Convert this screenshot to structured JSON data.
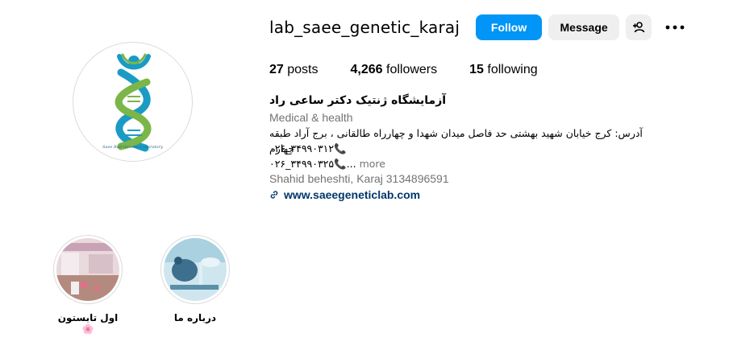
{
  "profile": {
    "username": "lab_saee_genetic_karaj",
    "avatar_caption": "Saee Rad Genetic Laboratory",
    "buttons": {
      "follow": "Follow",
      "message": "Message"
    },
    "stats": {
      "posts_count": "27",
      "posts_label": "posts",
      "followers_count": "4,266",
      "followers_label": "followers",
      "following_count": "15",
      "following_label": "following"
    },
    "bio": {
      "full_name": "آزمایشگاه ژنتیک دکتر ساعی راد",
      "category": "Medical & health",
      "line1": "آدرس: کرج خیابان شهید بهشتی حد فاصل میدان شهدا و چهارراه طالقانی ، برج آراد طبقه چهارم",
      "phone1": "۰۲۶_۳۴۹۹۰۳۱۲",
      "phone2": "۰۲۶_۳۴۹۹۰۳۲۵",
      "more": "more",
      "address": "Shahid beheshti, Karaj 3134896591",
      "website": "www.saeegeneticlab.com"
    }
  },
  "highlights": [
    {
      "label": "اول تابستون🌸"
    },
    {
      "label": "درباره ما"
    }
  ],
  "colors": {
    "follow_blue": "#0095f6",
    "button_gray": "#efefef",
    "link_blue": "#00376b",
    "secondary_text": "#737373",
    "dna_teal": "#1a9bc4",
    "dna_green": "#7ab648"
  },
  "icons": {
    "suggest": "person-add-icon",
    "more": "more-options-icon",
    "phone": "phone-icon",
    "link": "link-icon"
  }
}
